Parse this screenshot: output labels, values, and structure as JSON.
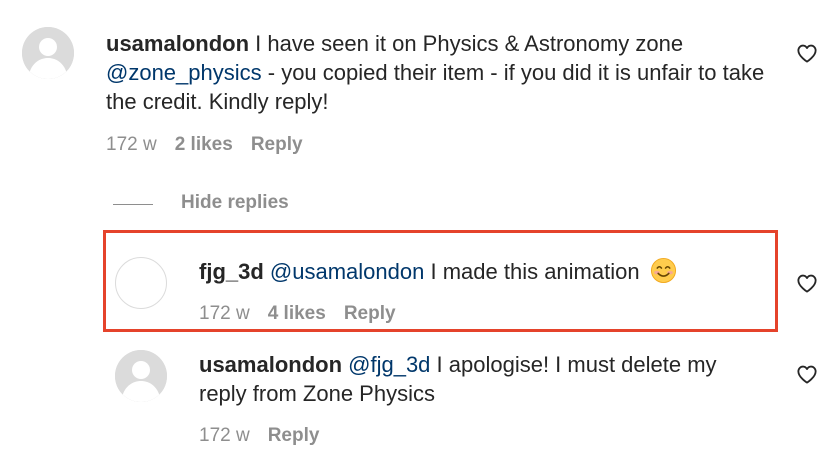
{
  "comments": [
    {
      "username": "usamalondon",
      "text_before": " I have seen it on Physics & Astronomy zone ",
      "mention": "@zone_physics",
      "text_after": " - you copied their item - if you did it is unfair to take the credit. Kindly reply!",
      "age": "172 w",
      "likes": "2 likes",
      "reply_label": "Reply"
    },
    {
      "username": "fjg_3d",
      "mention": "@usamalondon",
      "text_after": " I made this animation ",
      "emoji": "smiling-face-emoji",
      "age": "172 w",
      "likes": "4 likes",
      "reply_label": "Reply"
    },
    {
      "username": "usamalondon",
      "mention": "@fjg_3d",
      "text_after": " I apologise! I must delete my reply from Zone Physics",
      "age": "172 w",
      "reply_label": "Reply"
    }
  ],
  "hide_replies_label": "Hide replies",
  "highlight_color": "#e5432b",
  "mention_color": "#00376b",
  "meta_color": "#8e8e8e",
  "icons": [
    "default-avatar-icon",
    "heart-outline-icon",
    "smiling-face-emoji"
  ]
}
